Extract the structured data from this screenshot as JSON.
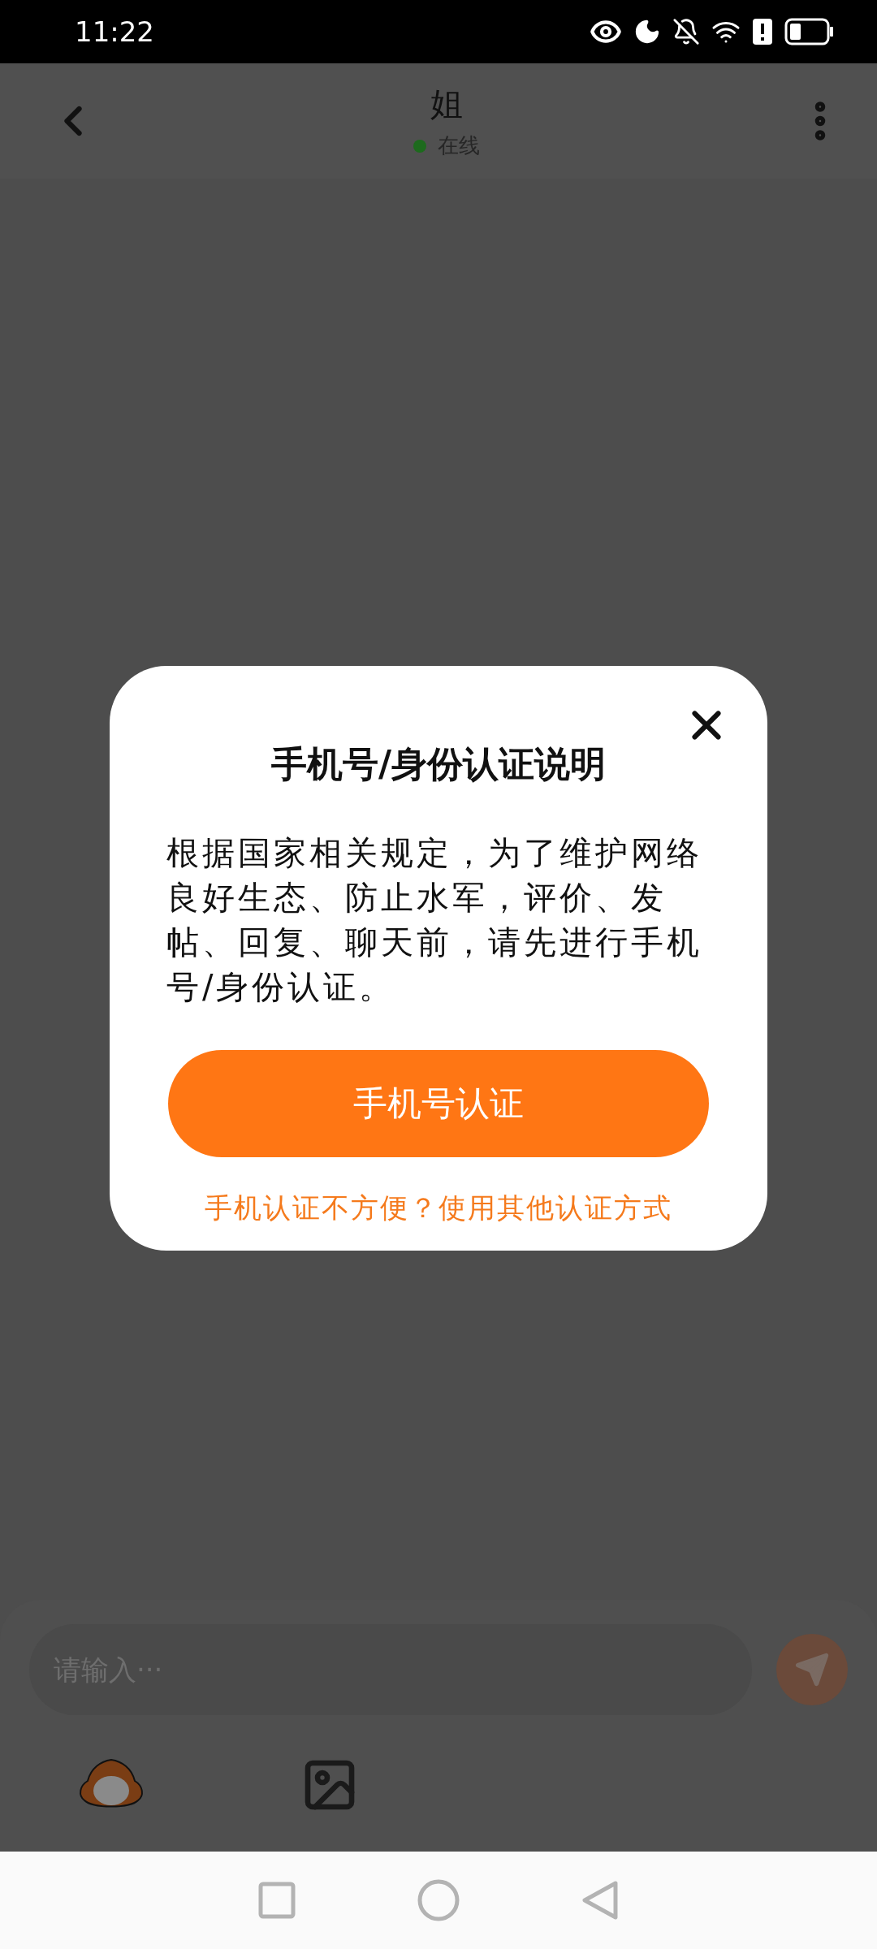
{
  "status_bar": {
    "time": "11:22"
  },
  "header": {
    "title": "姐",
    "status": "在线"
  },
  "dialog": {
    "title": "手机号/身份认证说明",
    "body": "根据国家相关规定，为了维护网络良好生态、防止水军，评价、发帖、回复、聊天前，请先进行手机号/身份认证。",
    "primary_button": "手机号认证",
    "alt_link": "手机认证不方便？使用其他认证方式"
  },
  "composer": {
    "placeholder": "请输入···"
  }
}
